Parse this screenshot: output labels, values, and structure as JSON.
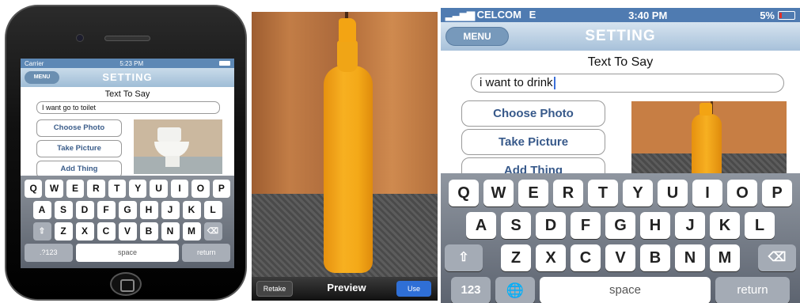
{
  "panel1": {
    "status": {
      "carrier": "Carrier",
      "time": "5:23 PM"
    },
    "nav": {
      "menu_label": "MENU",
      "title": "SETTING"
    },
    "text_label": "Text To Say",
    "text_value": "I want go to toilet",
    "buttons": {
      "choose_photo": "Choose Photo",
      "take_picture": "Take Picture",
      "add_thing": "Add Thing"
    },
    "keyboard": {
      "row1": [
        "Q",
        "W",
        "E",
        "R",
        "T",
        "Y",
        "U",
        "I",
        "O",
        "P"
      ],
      "row2": [
        "A",
        "S",
        "D",
        "F",
        "G",
        "H",
        "J",
        "K",
        "L"
      ],
      "row3": [
        "Z",
        "X",
        "C",
        "V",
        "B",
        "N",
        "M"
      ],
      "shift_glyph": "⇧",
      "delete_glyph": "⌫",
      "numbers_label": ".?123",
      "space_label": "space",
      "return_label": "return"
    }
  },
  "panel2": {
    "retake_label": "Retake",
    "title": "Preview",
    "use_label": "Use"
  },
  "panel3": {
    "status": {
      "carrier": "CELCOM",
      "network": "E",
      "time": "3:40 PM",
      "battery": "5%"
    },
    "nav": {
      "menu_label": "MENU",
      "title": "SETTING"
    },
    "text_label": "Text To Say",
    "text_value": "i want to drink",
    "buttons": {
      "choose_photo": "Choose Photo",
      "take_picture": "Take Picture",
      "add_thing": "Add Thing"
    },
    "keyboard": {
      "row1": [
        "Q",
        "W",
        "E",
        "R",
        "T",
        "Y",
        "U",
        "I",
        "O",
        "P"
      ],
      "row2": [
        "A",
        "S",
        "D",
        "F",
        "G",
        "H",
        "J",
        "K",
        "L"
      ],
      "row3": [
        "Z",
        "X",
        "C",
        "V",
        "B",
        "N",
        "M"
      ],
      "shift_glyph": "⇧",
      "delete_glyph": "⌫",
      "numbers_label": "123",
      "globe_glyph": "🌐",
      "space_label": "space",
      "return_label": "return"
    }
  }
}
